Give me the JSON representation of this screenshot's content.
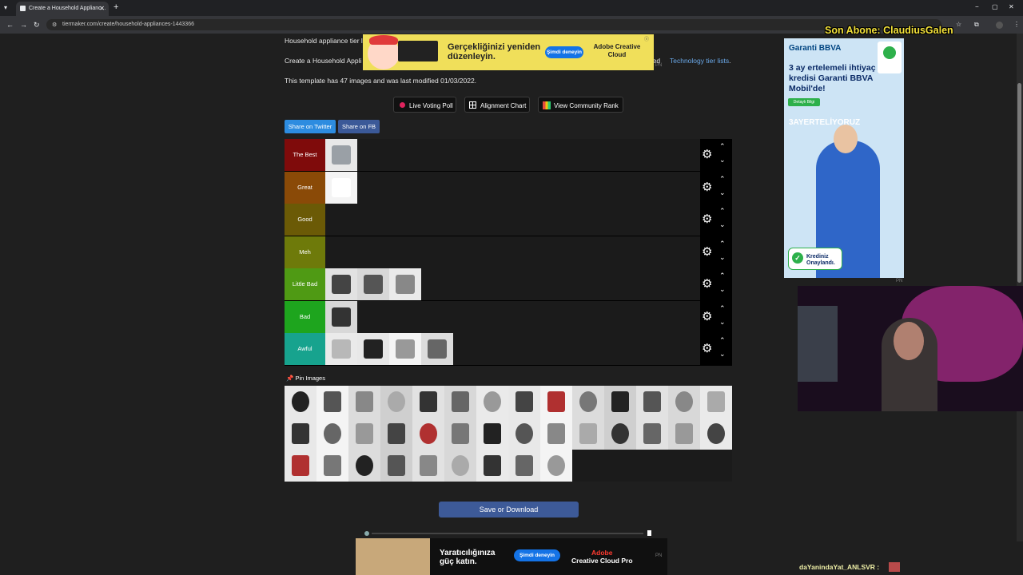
{
  "browser": {
    "tab_title": "Create a Household Applianc...",
    "new_tab": "+",
    "tab_close": "✕",
    "url": "tiermaker.com/create/household-appliances-1443366",
    "window_controls": [
      "−",
      "▢",
      "✕"
    ]
  },
  "page": {
    "heading_text": "Household appliance tier l",
    "desc_start": "Create a Household Appli",
    "desc_end_prefix": "...itted",
    "desc_link": "Technology tier lists",
    "desc_end": ".",
    "template_info": "This template has 47 images and was last modified 01/03/2022.",
    "buttons": {
      "live_voting": "Live Voting Poll",
      "alignment_chart": "Alignment Chart",
      "community_rank": "View Community Rank"
    },
    "share": {
      "twitter": "Share on Twitter",
      "facebook": "Share on FB"
    },
    "tiers": [
      {
        "label": "The Best",
        "color": "#7f0b0b",
        "items": [
          "air-conditioner"
        ]
      },
      {
        "label": "Great",
        "color": "#8a4a07",
        "items": [
          "toilet"
        ]
      },
      {
        "label": "Good",
        "color": "#6b5a06",
        "items": []
      },
      {
        "label": "Meh",
        "color": "#6e7a0a",
        "items": []
      },
      {
        "label": "Little Bad",
        "color": "#4f9a14",
        "items": [
          "standing-fan",
          "ceiling-fan",
          "shower-head"
        ]
      },
      {
        "label": "Bad",
        "color": "#1ea51e",
        "items": [
          "printer"
        ]
      },
      {
        "label": "Awful",
        "color": "#17a38e",
        "items": [
          "refrigerator",
          "gas-stove",
          "washing-machine",
          "cordless-phone"
        ]
      }
    ],
    "tier_controls": {
      "gear": "⚙",
      "up": "⌃",
      "down": "⌄"
    },
    "pin_images": "Pin Images",
    "pool_items": [
      "air-fryer",
      "bathtub",
      "blender",
      "can-opener",
      "coffee-maker",
      "slow-cooker",
      "curling-iron",
      "computer",
      "dishwasher",
      "front-loader",
      "griddle",
      "chest-freezer",
      "toaster-oven",
      "grill",
      "hair-dryer",
      "hand-mixer",
      "space-heater",
      "hot-plate",
      "instant-pot",
      "ironing-board",
      "coffee-grinder",
      "floor-lamp",
      "microwave",
      "range-oven",
      "paper-shredder",
      "rice-cooker",
      "sewing-machine",
      "sink",
      "smoker",
      "stand-mixer",
      "stereo",
      "hair-straightener",
      "toaster-oven-2",
      "toaster",
      "television",
      "vacuum",
      "waffle-maker"
    ],
    "save_button": "Save or Download"
  },
  "ads": {
    "top": {
      "headline": "Gerçekliğinizi yeniden düzenleyin.",
      "button": "Şimdi deneyin",
      "brand": "Adobe Creative Cloud",
      "tag": "PN"
    },
    "side": {
      "logo": "Garanti BBVA",
      "headline": "3 ay ertelemeli ihtiyaç kredisi Garanti BBVA Mobil'de!",
      "details": "Detaylı Bilgi",
      "banner": "3AYERTELİYORUZ",
      "badge": "Krediniz Onaylandı.",
      "tag": "PN"
    },
    "bottom": {
      "headline": "Yaratıcılığınıza güç katın.",
      "button": "Şimdi deneyin",
      "brand_top": "Adobe",
      "brand_bottom": "Creative Cloud Pro",
      "tag": "PN"
    }
  },
  "stream": {
    "latest_subscriber": "Son Abone: ClaudiusGalen",
    "chat_message": "daYanindaYat_ANLSVR :"
  }
}
